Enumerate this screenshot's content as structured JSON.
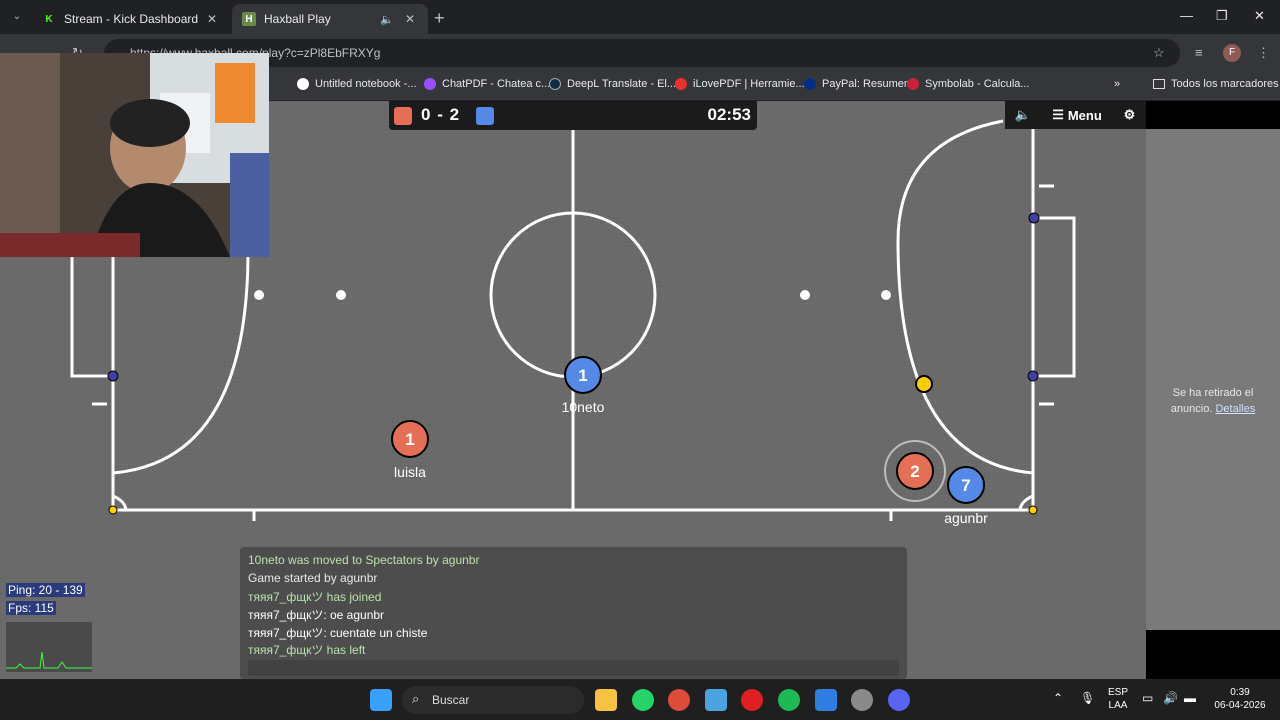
{
  "browser": {
    "tabs": [
      {
        "title": "Stream - Kick Dashboard",
        "favicon": "K",
        "favicon_color": "#53fc18"
      },
      {
        "title": "Haxball Play",
        "favicon": "H",
        "favicon_color": "#6a8a4a"
      }
    ],
    "new_tab_symbol": "+",
    "url": "https://www.haxball.com/play?c=zPl8EbFRXYg",
    "profile_initial": "F",
    "window_controls": [
      "—",
      "❐",
      "✕"
    ]
  },
  "bookmarks": {
    "items": [
      {
        "label": "Untitled notebook -...",
        "color": "#ffffff"
      },
      {
        "label": "ChatPDF - Chatea c...",
        "color": "#9b4dff"
      },
      {
        "label": "DeepL Translate - El...",
        "color": "#0f2b46"
      },
      {
        "label": "iLovePDF | Herramie...",
        "color": "#e5322d"
      },
      {
        "label": "PayPal: Resumen",
        "color": "#003087"
      },
      {
        "label": "Symbolab - Calcula...",
        "color": "#c7233b"
      }
    ],
    "folder_label": "Todos los marcadores",
    "overflow_symbol": "»"
  },
  "scoreboard": {
    "red_score": "0",
    "separator": "-",
    "blue_score": "2",
    "time": "02:53"
  },
  "controls": {
    "sound_icon": "speaker-icon",
    "menu_label": "Menu",
    "settings_icon": "gear-icon"
  },
  "players": [
    {
      "number": "1",
      "name": "10neto",
      "team": "blue"
    },
    {
      "number": "1",
      "name": "luisla",
      "team": "red"
    },
    {
      "number": "2",
      "name": "",
      "team": "red"
    },
    {
      "number": "7",
      "name": "agunbr",
      "team": "blue"
    }
  ],
  "colors": {
    "red_team": "#e56e56",
    "blue_team": "#5689e5",
    "ball": "#ffcc00",
    "field": "#6a6a6a",
    "lines": "#ffffff"
  },
  "chat": {
    "messages": [
      {
        "text": "10neto was moved to Spectators by agunbr",
        "color": "#b8e4a8"
      },
      {
        "text": "Game started by agunbr",
        "color": "#e8e8e8"
      },
      {
        "text": "тяяя7_фщкツ has joined",
        "color": "#b8e4a8"
      },
      {
        "text": "тяяя7_фщкツ: oe agunbr",
        "color": "#ffffff"
      },
      {
        "text": "тяяя7_фщкツ: cuentate un chiste",
        "color": "#ffffff"
      },
      {
        "text": "тяяя7_фщкツ has left",
        "color": "#b8e4a8"
      }
    ]
  },
  "stats": {
    "ping": "Ping: 20 - 139",
    "fps": "Fps: 115"
  },
  "ad": {
    "text": "Se ha retirado el anuncio.",
    "link": "Detalles"
  },
  "taskbar": {
    "search_label": "Buscar",
    "language": "ESP",
    "layout": "LAA",
    "time": "0:39",
    "date": "06-04-2026"
  }
}
